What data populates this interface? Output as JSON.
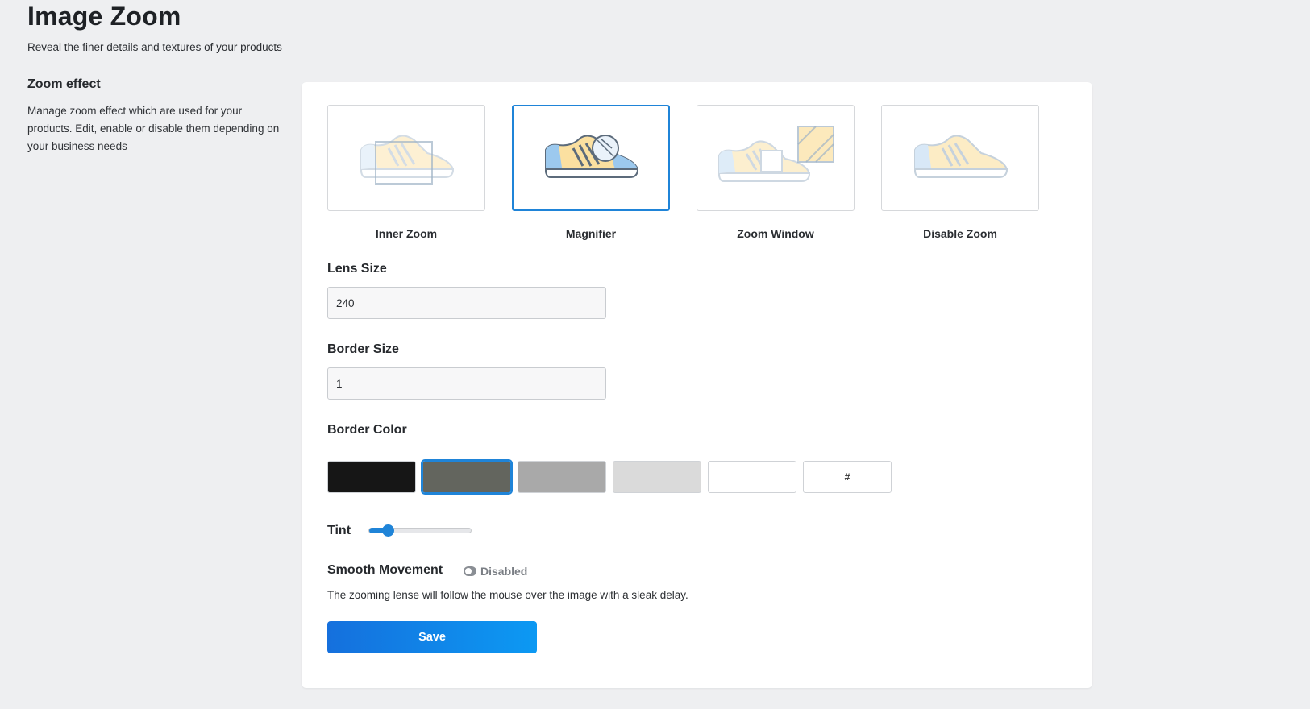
{
  "header": {
    "title": "Image Zoom",
    "subtitle": "Reveal the finer details and textures of your products"
  },
  "section": {
    "title": "Zoom effect",
    "description": "Manage zoom effect which are used for your products. Edit, enable or disable them depending on your business needs"
  },
  "effects": [
    {
      "label": "Inner Zoom",
      "icon": "shoe-inner-zoom-icon",
      "selected": false
    },
    {
      "label": "Magnifier",
      "icon": "shoe-magnifier-icon",
      "selected": true
    },
    {
      "label": "Zoom Window",
      "icon": "shoe-zoom-window-icon",
      "selected": false
    },
    {
      "label": "Disable Zoom",
      "icon": "shoe-disable-zoom-icon",
      "selected": false
    }
  ],
  "lens_size": {
    "label": "Lens Size",
    "value": "240"
  },
  "border_size": {
    "label": "Border Size",
    "value": "1"
  },
  "border_color": {
    "label": "Border Color",
    "swatches": [
      "#161616",
      "#63655e",
      "#a9a9a9",
      "#dadada",
      "#ffffff"
    ],
    "selected_index": 1,
    "custom_label": "#"
  },
  "tint": {
    "label": "Tint",
    "value": 0.18
  },
  "smooth_movement": {
    "label": "Smooth Movement",
    "state": "Disabled",
    "description": "The zooming lense will follow the mouse over the image with a sleak delay."
  },
  "save_label": "Save",
  "colors": {
    "accent": "#1f84d8",
    "shoe_yellow": "#fbe0a0",
    "shoe_blue": "#bfdaf2"
  }
}
